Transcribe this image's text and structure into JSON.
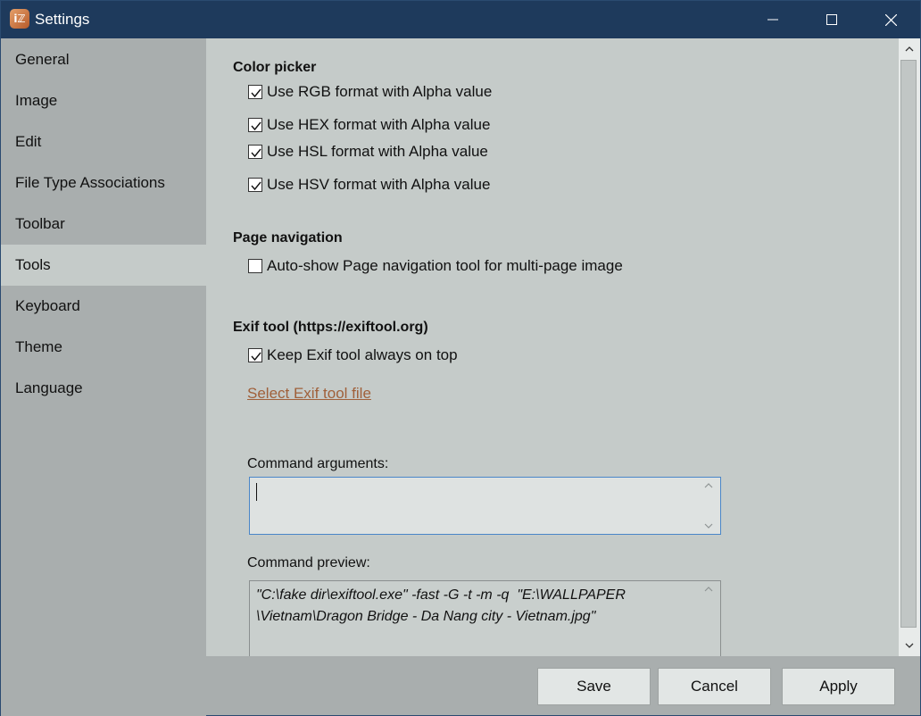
{
  "window": {
    "title": "Settings",
    "app_icon_glyph": "iℤ",
    "minimize_icon": "minimize-icon",
    "maximize_icon": "maximize-icon",
    "close_icon": "close-icon"
  },
  "sidebar": {
    "items": [
      {
        "label": "General"
      },
      {
        "label": "Image"
      },
      {
        "label": "Edit"
      },
      {
        "label": "File Type Associations"
      },
      {
        "label": "Toolbar"
      },
      {
        "label": "Tools",
        "active": true
      },
      {
        "label": "Keyboard"
      },
      {
        "label": "Theme"
      },
      {
        "label": "Language"
      }
    ]
  },
  "content": {
    "color_picker": {
      "title": "Color picker",
      "options": [
        {
          "label": "Use RGB format with Alpha value",
          "checked": true
        },
        {
          "label": "Use HEX format with Alpha value",
          "checked": true
        },
        {
          "label": "Use HSL format with Alpha value",
          "checked": true
        },
        {
          "label": "Use HSV format with Alpha value",
          "checked": true
        }
      ]
    },
    "page_navigation": {
      "title": "Page navigation",
      "options": [
        {
          "label": "Auto-show Page navigation tool for multi-page image",
          "checked": false
        }
      ]
    },
    "exif_tool": {
      "title": "Exif tool (https://exiftool.org)",
      "options": [
        {
          "label": "Keep Exif tool always on top",
          "checked": true
        }
      ],
      "select_file_link": "Select Exif tool file",
      "command_arguments_label": "Command arguments:",
      "command_arguments_value": "",
      "command_preview_label": "Command preview:",
      "command_preview_value": "\"C:\\fake dir\\exiftool.exe\" -fast -G -t -m -q  \"E:\\WALLPAPER\n\\Vietnam\\Dragon Bridge - Da Nang city - Vietnam.jpg\""
    }
  },
  "footer": {
    "save_label": "Save",
    "cancel_label": "Cancel",
    "apply_label": "Apply"
  },
  "colors": {
    "titlebar": "#1e3a5c",
    "sidebar": "#a9aeae",
    "content": "#c5cbc9",
    "link": "#a0603a",
    "focus_border": "#4a86c8"
  }
}
